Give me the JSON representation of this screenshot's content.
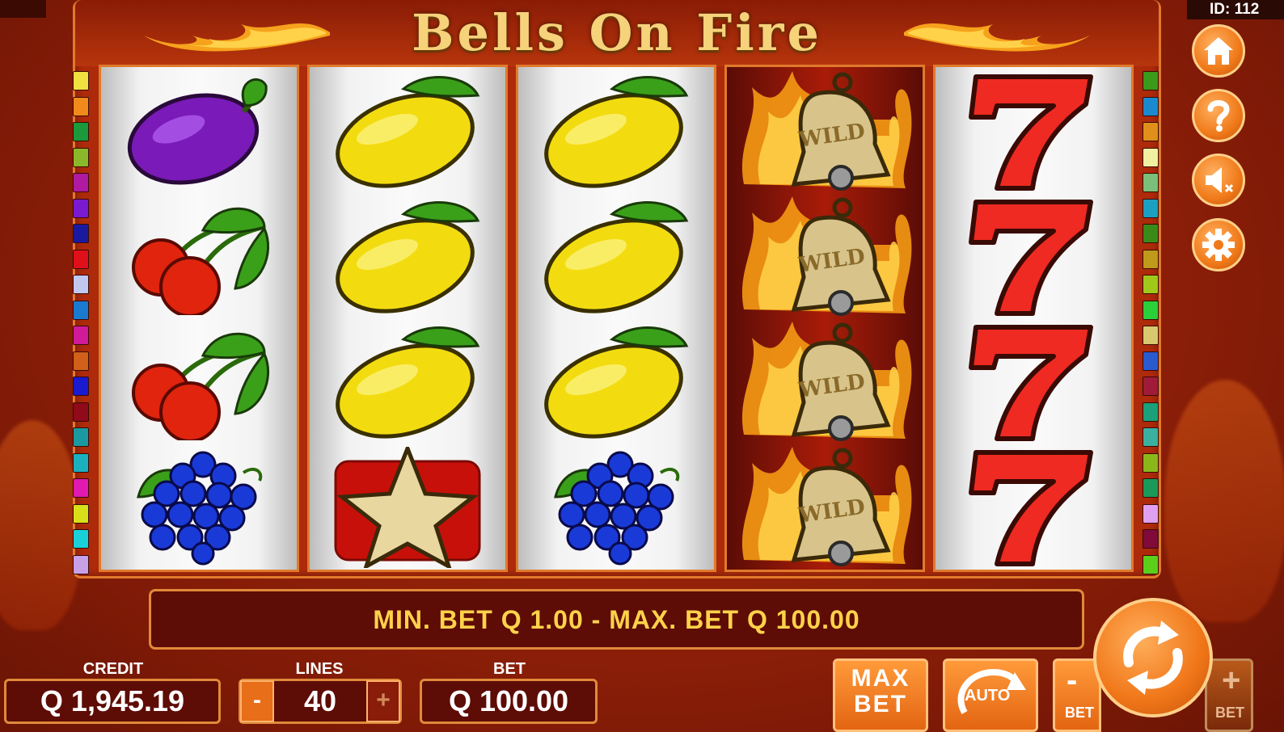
{
  "game": {
    "title": "Bells On Fire",
    "id_label": "ID: 112"
  },
  "reels": [
    [
      "plum",
      "cherries",
      "cherries",
      "grapes"
    ],
    [
      "lemon",
      "lemon",
      "lemon",
      "star"
    ],
    [
      "lemon",
      "lemon",
      "lemon",
      "grapes"
    ],
    [
      "wild-bell",
      "wild-bell",
      "wild-bell",
      "wild-bell"
    ],
    [
      "seven",
      "seven",
      "seven",
      "seven"
    ]
  ],
  "wild_text": "WILD",
  "message": "MIN. BET Q 1.00 - MAX. BET Q 100.00",
  "credit": {
    "label": "CREDIT",
    "value": "Q 1,945.19"
  },
  "lines": {
    "label": "LINES",
    "value": "40",
    "minus": "-",
    "plus": "+"
  },
  "bet": {
    "label": "BET",
    "value": "Q 100.00"
  },
  "buttons": {
    "max_bet_line1": "MAX",
    "max_bet_line2": "BET",
    "auto": "AUTO",
    "bet_minus_label": "BET",
    "bet_plus_label": "BET",
    "minus": "-",
    "plus": "+"
  },
  "side_icons": [
    "home-icon",
    "help-icon",
    "sound-off-icon",
    "settings-icon"
  ],
  "colors": {
    "accent": "#f07a1a",
    "message_text": "#ffd24a",
    "background": "#a8290b"
  }
}
